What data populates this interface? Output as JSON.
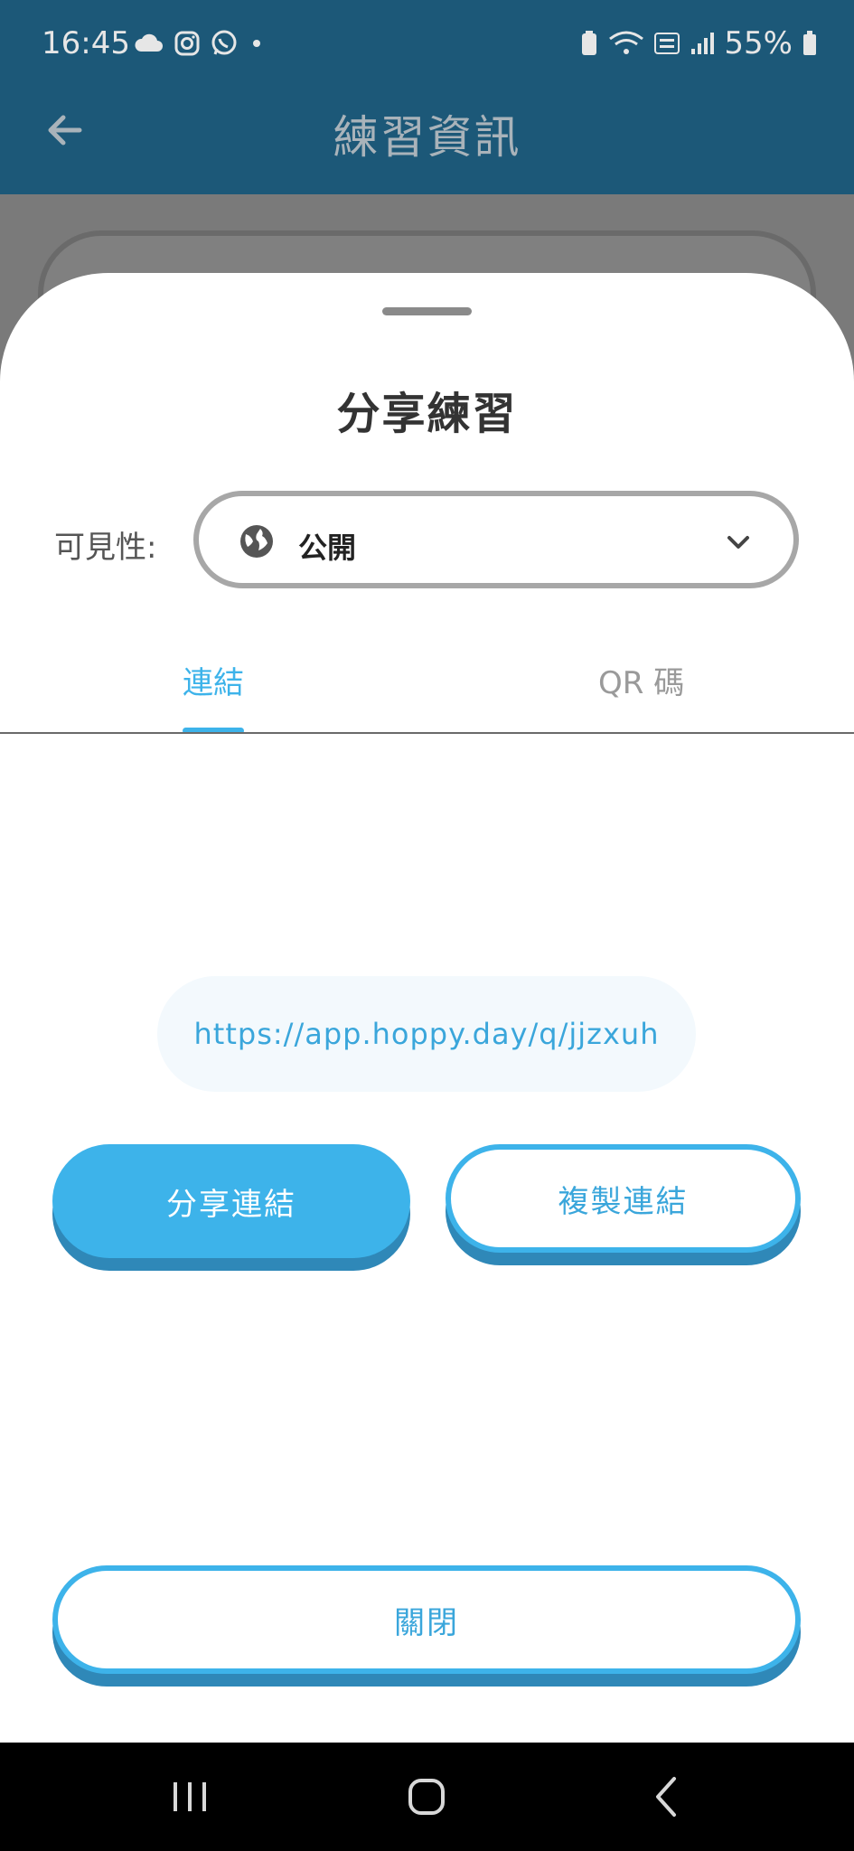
{
  "status_bar": {
    "time": "16:45",
    "battery": "55%"
  },
  "app_bar": {
    "title": "練習資訊"
  },
  "sheet": {
    "title": "分享練習",
    "visibility_label": "可見性:",
    "visibility_value": "公開",
    "tabs": [
      {
        "label": "連結",
        "active": true
      },
      {
        "label": "QR 碼",
        "active": false
      }
    ],
    "link_url": "https://app.hoppy.day/q/jjzxuh",
    "share_button": "分享連結",
    "copy_button": "複製連結",
    "close_button": "關閉"
  },
  "colors": {
    "accent": "#3db3ea",
    "accent_shadow": "#2f88b8",
    "app_bar": "#1c5878"
  }
}
